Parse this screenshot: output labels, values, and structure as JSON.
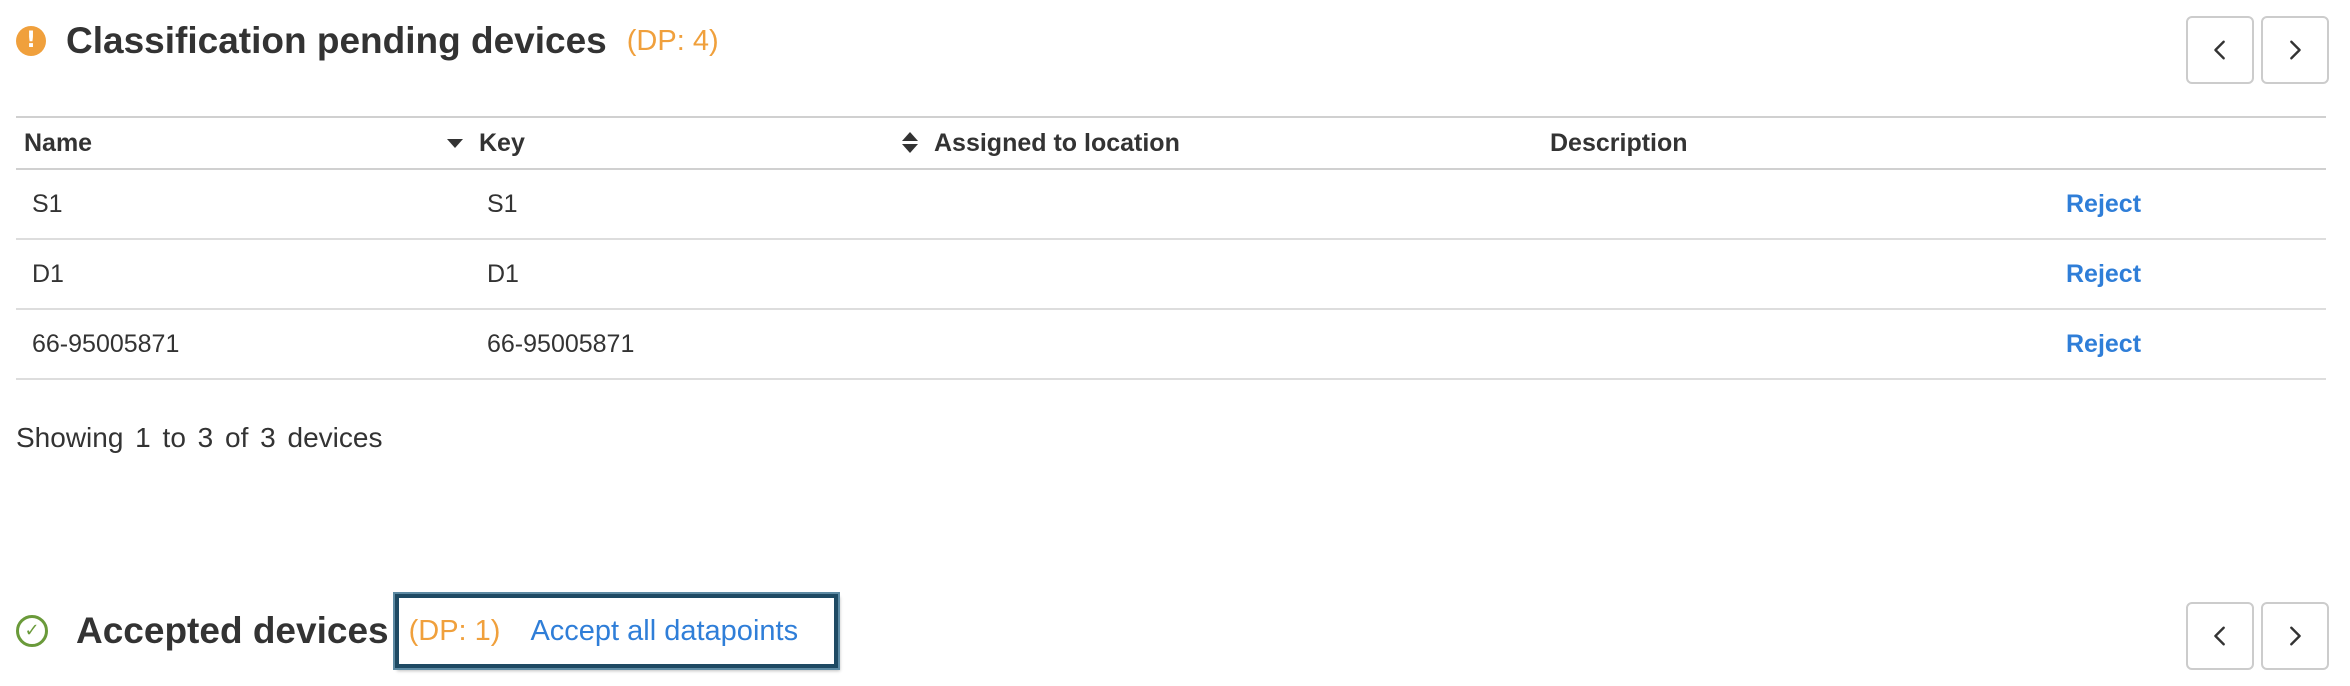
{
  "pending_section": {
    "title": "Classification pending devices",
    "dp_count": "(DP: 4)",
    "icon": "warning-icon",
    "accent_color": "#f0a03c"
  },
  "table": {
    "headers": {
      "name": "Name",
      "key": "Key",
      "location": "Assigned to location",
      "description": "Description"
    },
    "rows": [
      {
        "name": "S1",
        "key": "S1",
        "location": "",
        "description": "",
        "action": "Reject"
      },
      {
        "name": "D1",
        "key": "D1",
        "location": "",
        "description": "",
        "action": "Reject"
      },
      {
        "name": "66-95005871",
        "key": "66-95005871",
        "location": "",
        "description": "",
        "action": "Reject"
      }
    ]
  },
  "footer": {
    "info": "Showing 1  to  3  of  3 devices"
  },
  "accepted_section": {
    "title": "Accepted devices",
    "dp_count": "(DP: 1)",
    "accept_all_label": "Accept all datapoints",
    "icon": "check-circle-icon",
    "status_color": "#6a9a3a",
    "link_color": "#2f7ed8"
  },
  "pager": {
    "prev_icon": "chevron-left-icon",
    "next_icon": "chevron-right-icon"
  }
}
